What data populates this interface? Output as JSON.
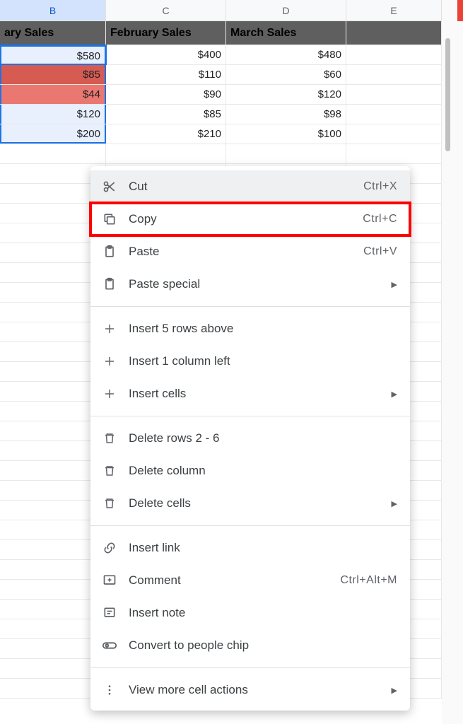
{
  "columns": {
    "B": "B",
    "C": "C",
    "D": "D",
    "E": "E"
  },
  "headers": {
    "B": "ary Sales",
    "C": "February Sales",
    "D": "March Sales"
  },
  "rows": [
    {
      "B": "$580",
      "C": "$400",
      "D": "$480"
    },
    {
      "B": "$85",
      "C": "$110",
      "D": "$60"
    },
    {
      "B": "$44",
      "C": "$90",
      "D": "$120"
    },
    {
      "B": "$120",
      "C": "$85",
      "D": "$98"
    },
    {
      "B": "$200",
      "C": "$210",
      "D": "$100"
    }
  ],
  "menu": {
    "cut": {
      "label": "Cut",
      "shortcut": "Ctrl+X"
    },
    "copy": {
      "label": "Copy",
      "shortcut": "Ctrl+C"
    },
    "paste": {
      "label": "Paste",
      "shortcut": "Ctrl+V"
    },
    "pasteSpecial": {
      "label": "Paste special"
    },
    "insertRows": {
      "label": "Insert 5 rows above"
    },
    "insertCol": {
      "label": "Insert 1 column left"
    },
    "insertCells": {
      "label": "Insert cells"
    },
    "delRows": {
      "label": "Delete rows 2 - 6"
    },
    "delCol": {
      "label": "Delete column"
    },
    "delCells": {
      "label": "Delete cells"
    },
    "insertLink": {
      "label": "Insert link"
    },
    "comment": {
      "label": "Comment",
      "shortcut": "Ctrl+Alt+M"
    },
    "insertNote": {
      "label": "Insert note"
    },
    "peopleChip": {
      "label": "Convert to people chip"
    },
    "viewMore": {
      "label": "View more cell actions"
    }
  }
}
